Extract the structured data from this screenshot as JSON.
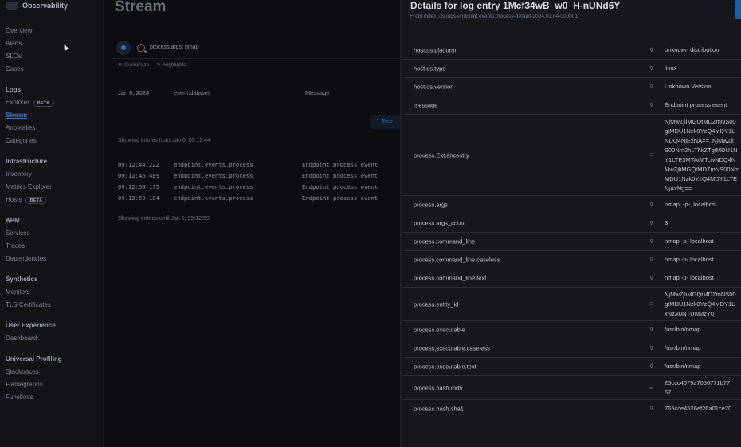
{
  "app": {
    "title": "Observability"
  },
  "sidebar": {
    "groups": [
      {
        "title": "",
        "items": [
          {
            "label": "Overview"
          },
          {
            "label": "Alerts"
          },
          {
            "label": "SLOs"
          },
          {
            "label": "Cases"
          }
        ]
      },
      {
        "title": "Logs",
        "items": [
          {
            "label": "Explorer",
            "badge": "BETA"
          },
          {
            "label": "Stream",
            "active": true
          },
          {
            "label": "Anomalies"
          },
          {
            "label": "Categories"
          }
        ]
      },
      {
        "title": "Infrastructure",
        "items": [
          {
            "label": "Inventory"
          },
          {
            "label": "Metrics Explorer"
          },
          {
            "label": "Hosts",
            "badge": "BETA"
          }
        ]
      },
      {
        "title": "APM",
        "items": [
          {
            "label": "Services"
          },
          {
            "label": "Traces"
          },
          {
            "label": "Dependencies"
          }
        ]
      },
      {
        "title": "Synthetics",
        "items": [
          {
            "label": "Monitors"
          },
          {
            "label": "TLS Certificates"
          }
        ]
      },
      {
        "title": "User Experience",
        "items": [
          {
            "label": "Dashboard"
          }
        ]
      },
      {
        "title": "Universal Profiling",
        "items": [
          {
            "label": "Stacktraces"
          },
          {
            "label": "Flamegraphs"
          },
          {
            "label": "Functions"
          }
        ]
      }
    ]
  },
  "stream": {
    "title": "Stream",
    "query": "process.args: nmap",
    "customize_label": "Customize",
    "highlights_label": "Highlights",
    "columns": {
      "date": "Jan 6, 2024",
      "dataset": "event.dataset",
      "message": "Message"
    },
    "extend_label": "Exte",
    "showing_from": "Showing entries from Jan 6, 09:12:44",
    "showing_until": "Showing entries until Jan 6, 09:12:59",
    "rows": [
      {
        "time": "09:12:44.222",
        "dataset": "endpoint.events.process",
        "message": "Endpoint process event"
      },
      {
        "time": "09:12:46.489",
        "dataset": "endpoint.events.process",
        "message": "Endpoint process event"
      },
      {
        "time": "09:12:59.175",
        "dataset": "endpoint.events.process",
        "message": "Endpoint process event"
      },
      {
        "time": "09:12:59.184",
        "dataset": "endpoint.events.process",
        "message": "Endpoint process event"
      }
    ]
  },
  "flyout": {
    "title": "Details for log entry 1Mcf34wB_w0_H-nUNd6Y",
    "subtitle": "From index .ds-logs-endpoint.events.process-default-2024.01.04-000001",
    "fields": [
      {
        "key": "host.os.platform",
        "value": [
          "unknown distribution"
        ]
      },
      {
        "key": "host.os.type",
        "value": [
          "linux"
        ]
      },
      {
        "key": "host.os.version",
        "value": [
          "Unknown Version"
        ]
      },
      {
        "key": "message",
        "value": [
          "Endpoint process event"
        ]
      },
      {
        "key": "process.Ext.ancestry",
        "value": [
          "NjMwZjliMGQtMDZmNS00",
          "gtMDU1Nzk0YzQ4MDY1L",
          "NDQ4NjExNA==, NjMwZjl",
          "S00Nm2hLThkZTgtMDU1N",
          "Y1LTE3MTAtMTcwNDQ4N",
          "MwZjliMGQtMDZmNS00Nm",
          "MDU1Nzk0YzQ4MDY1LTE",
          "NjAxNg=="
        ]
      },
      {
        "key": "process.args",
        "value": [
          "nmap, -p-, localhost"
        ]
      },
      {
        "key": "process.args_count",
        "value": [
          "3"
        ]
      },
      {
        "key": "process.command_line",
        "value": [
          "nmap -p- localhost"
        ]
      },
      {
        "key": "process.command_line.caseless",
        "value": [
          "nmap -p- localhost"
        ]
      },
      {
        "key": "process.command_line.text",
        "value": [
          "nmap -p- localhost"
        ]
      },
      {
        "key": "process.entity_id",
        "value": [
          "NjMwZjliMGQtMDZmNS00",
          "gtMDU1Nzk0YzQ4MDY1L",
          "xNzA0NTUwMzY0"
        ]
      },
      {
        "key": "process.executable",
        "value": [
          "/usr/bin/nmap"
        ]
      },
      {
        "key": "process.executable.caseless",
        "value": [
          "/usr/bin/nmap"
        ]
      },
      {
        "key": "process.executable.text",
        "value": [
          "/usr/bin/nmap"
        ]
      },
      {
        "key": "process.hash.md5",
        "value": [
          "25ccc4679a7056771b77",
          "57"
        ]
      },
      {
        "key": "process.hash.sha1",
        "value": [
          "765cce4526ef26a01ce20"
        ]
      }
    ]
  },
  "colors": {
    "accent": "#3d7cc9",
    "background": "#0b0c0f",
    "flyout_bg": "#15171c"
  }
}
